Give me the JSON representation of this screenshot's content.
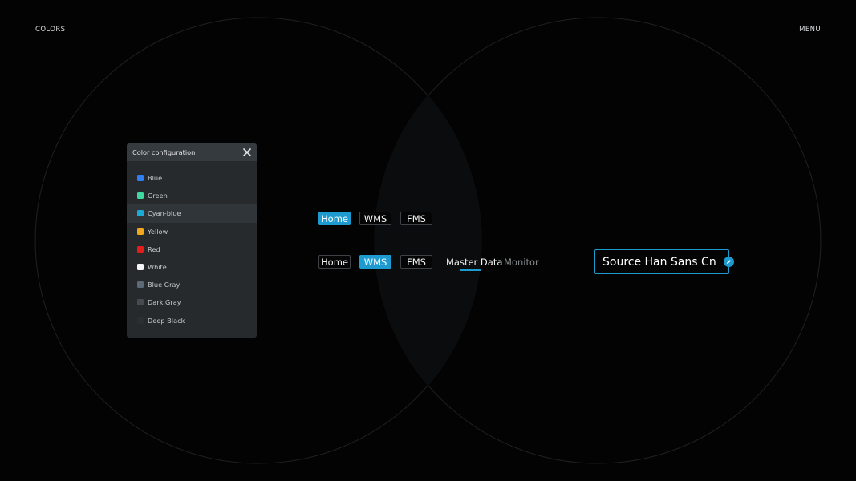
{
  "header": {
    "left_label": "COLORS",
    "right_label": "MENU"
  },
  "color_panel": {
    "title": "Color configuration",
    "close_icon": "close-icon",
    "items": [
      {
        "label": "Blue",
        "color": "#2f7ff0"
      },
      {
        "label": "Green",
        "color": "#3fd8a0"
      },
      {
        "label": "Cyan-blue",
        "color": "#1ca9d6",
        "highlighted": true
      },
      {
        "label": "Yellow",
        "color": "#f0a81c"
      },
      {
        "label": "Red",
        "color": "#e41c1c"
      },
      {
        "label": "White",
        "color": "#f4f6f8"
      },
      {
        "label": "Blue Gray",
        "color": "#5c6a77"
      },
      {
        "label": "Dark Gray",
        "color": "#454b50"
      },
      {
        "label": "Deep Black",
        "color": "#2b2f33"
      }
    ]
  },
  "button_row_1": {
    "buttons": [
      {
        "label": "Home",
        "active": true
      },
      {
        "label": "WMS",
        "active": false
      },
      {
        "label": "FMS",
        "active": false
      }
    ]
  },
  "button_row_2": {
    "buttons": [
      {
        "label": "Home",
        "active": false
      },
      {
        "label": "WMS",
        "active": true
      },
      {
        "label": "FMS",
        "active": false
      }
    ],
    "tabs": [
      {
        "label": "Master Data",
        "active": true
      },
      {
        "label": "Monitor",
        "active": false
      }
    ]
  },
  "font_field": {
    "value": "Source Han Sans Cn",
    "edit_icon": "pencil-icon"
  },
  "colors": {
    "accent": "#1d9bd1",
    "background": "#030303",
    "panel": "#262a2d"
  }
}
